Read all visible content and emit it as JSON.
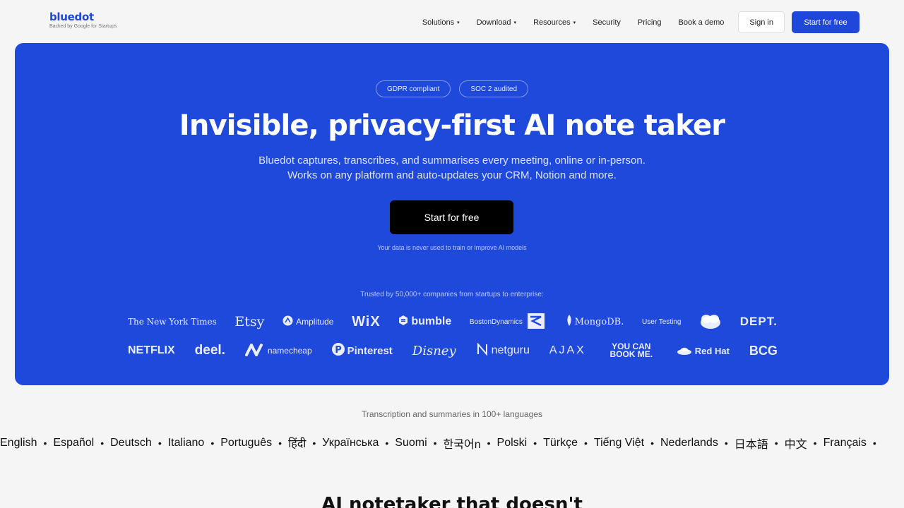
{
  "brand": {
    "name": "bluedot",
    "tagline": "Backed by Google for Startups"
  },
  "nav": {
    "items": [
      {
        "label": "Solutions",
        "dropdown": true
      },
      {
        "label": "Download",
        "dropdown": true
      },
      {
        "label": "Resources",
        "dropdown": true
      },
      {
        "label": "Security",
        "dropdown": false
      },
      {
        "label": "Pricing",
        "dropdown": false
      },
      {
        "label": "Book a demo",
        "dropdown": false
      }
    ],
    "caret": "▾",
    "sign_in": "Sign in",
    "start": "Start for free"
  },
  "hero": {
    "badges": [
      "GDPR compliant",
      "SOC 2 audited"
    ],
    "title": "Invisible, privacy-first AI note taker",
    "subtitle_line1": "Bluedot captures, transcribes, and summarises every meeting, online or in-person.",
    "subtitle_line2": "Works on any platform and auto-updates your CRM, Notion and more.",
    "cta": "Start for free",
    "note": "Your data is never used to train or improve AI models",
    "trusted": "Trusted by 50,000+ companies from startups to enterprise:",
    "logos_row1": [
      "The New York Times",
      "Etsy",
      "Amplitude",
      "WiX",
      "bumble",
      "BostonDynamics",
      "MongoDB.",
      "User Testing",
      "salesforce",
      "DEPT."
    ],
    "logos_row2": [
      "NETFLIX",
      "deel.",
      "namecheap",
      "Pinterest",
      "Disney",
      "netguru",
      "AJAX",
      "YOU CAN BOOK ME.",
      "Red Hat",
      "BCG"
    ]
  },
  "languages": {
    "heading": "Transcription and summaries in 100+ languages",
    "list": [
      "English",
      "Español",
      "Deutsch",
      "Italiano",
      "Português",
      "हिंदी",
      "Українська",
      "Suomi",
      "한국어n",
      "Polski",
      "Türkçe",
      "Tiếng Việt",
      "Nederlands",
      "日本語",
      "中文",
      "Français"
    ],
    "separator": "•"
  },
  "next_section": {
    "heading": "AI notetaker that doesn't"
  },
  "colors": {
    "primary": "#1f47d9",
    "hero_bg": "#1e49db",
    "page_bg": "#f5f5f5"
  }
}
